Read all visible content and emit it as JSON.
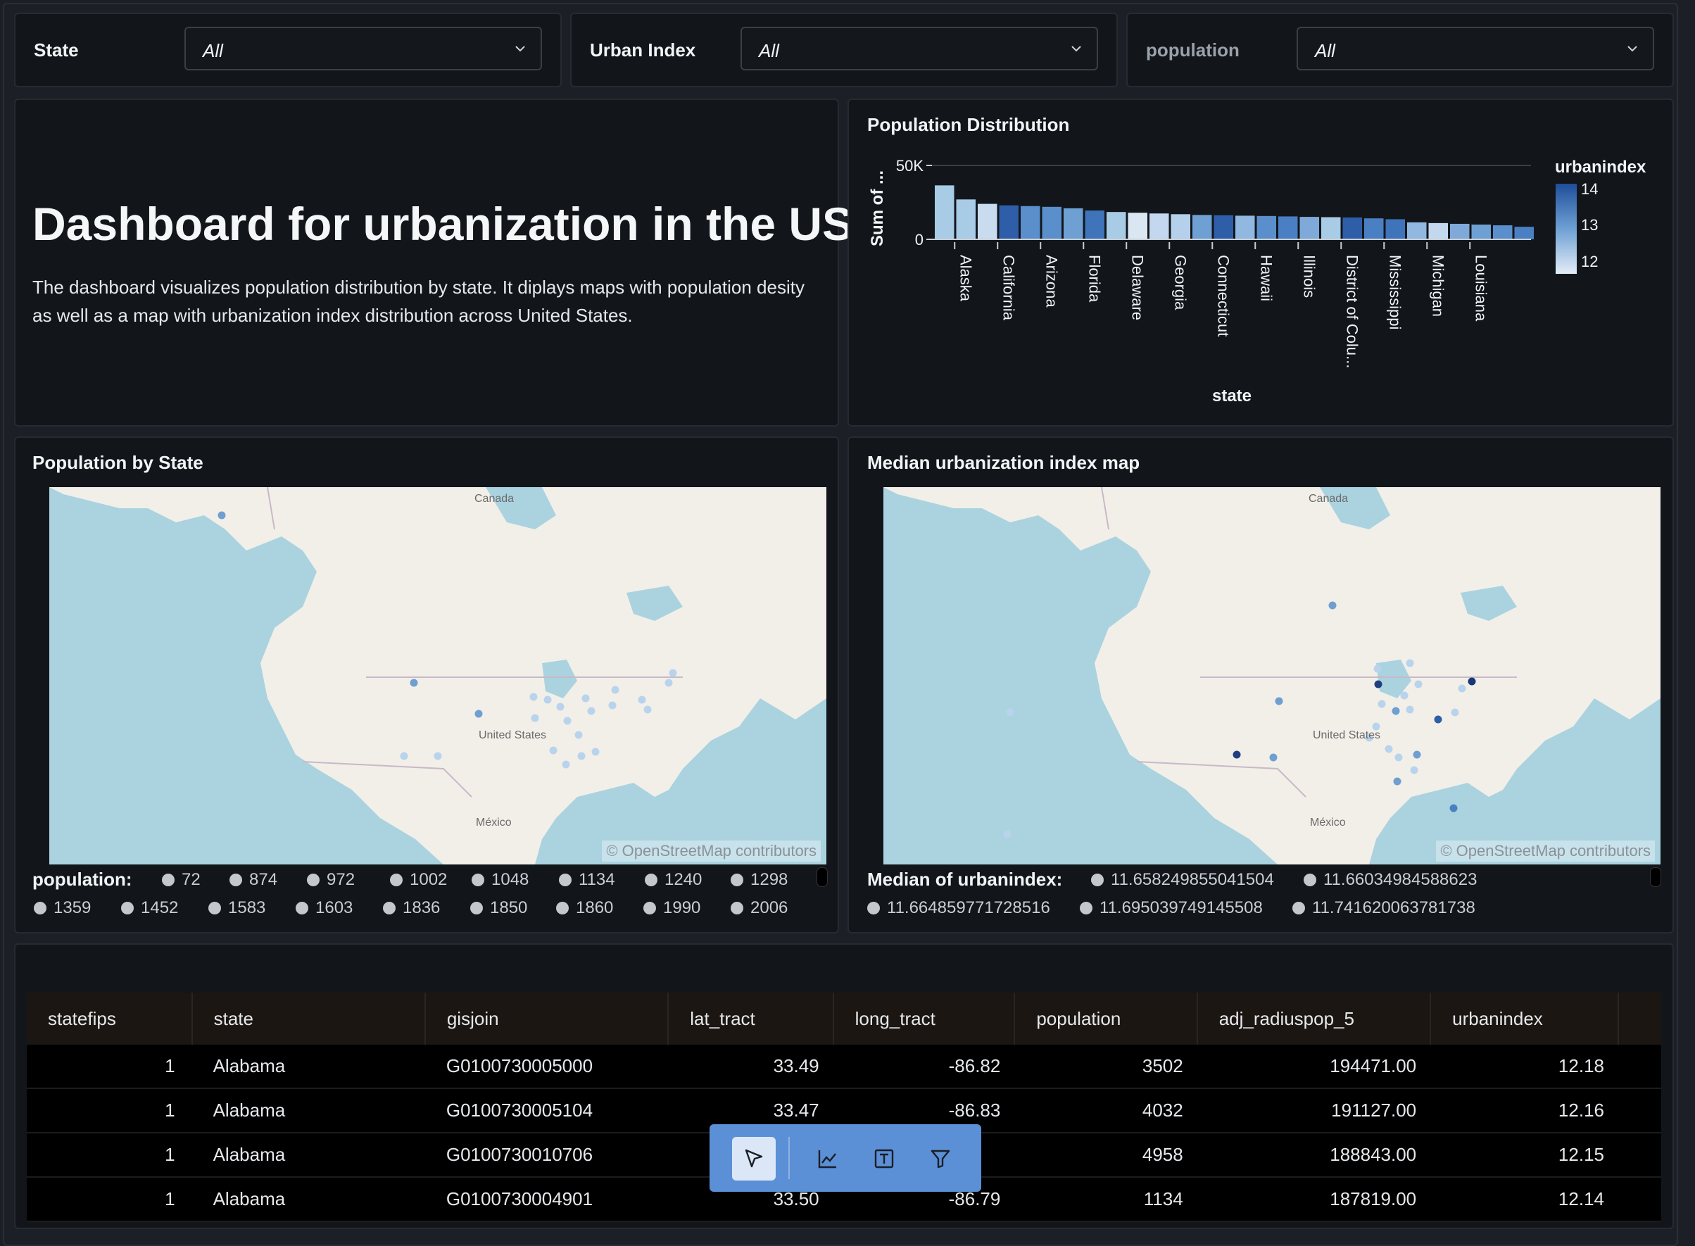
{
  "filters": [
    {
      "label": "State",
      "value": "All"
    },
    {
      "label": "Urban Index",
      "value": "All"
    },
    {
      "label": "population",
      "value": "All"
    }
  ],
  "intro": {
    "title": "Dashboard for urbanization in the US",
    "description": "The dashboard visualizes population distribution by state. It diplays maps with population desity as well as a map with urbanization index distribution across United States."
  },
  "bar_chart": {
    "title": "Population Distribution",
    "ytick_top": "50K",
    "ytick_zero": "0",
    "legend_title": "urbanindex",
    "legend_ticks": [
      "14",
      "13",
      "12"
    ]
  },
  "chart_data": {
    "type": "bar",
    "title": "Population Distribution",
    "xlabel": "state",
    "ylabel": "Sum of ...",
    "ylim": [
      0,
      50000
    ],
    "categories": [
      "Alaska",
      "California",
      "Arizona",
      "Florida",
      "Delaware",
      "Georgia",
      "Connecticut",
      "Hawaii",
      "Illinois",
      "District of Colu...",
      "Mississippi",
      "Michigan",
      "Louisiana"
    ],
    "bars": [
      {
        "value": 36500,
        "color": "#a8cbe6"
      },
      {
        "value": 27000,
        "color": "#a8cbe6"
      },
      {
        "value": 24000,
        "color": "#c9dcef"
      },
      {
        "value": 23000,
        "color": "#2e5ea8"
      },
      {
        "value": 22500,
        "color": "#5a8fcb"
      },
      {
        "value": 22000,
        "color": "#5a8fcb"
      },
      {
        "value": 21000,
        "color": "#6ea0d4"
      },
      {
        "value": 19500,
        "color": "#3f73ba"
      },
      {
        "value": 18500,
        "color": "#a8cbe6"
      },
      {
        "value": 18000,
        "color": "#dbe6f3"
      },
      {
        "value": 17500,
        "color": "#c3d8ee"
      },
      {
        "value": 17000,
        "color": "#b5d0eb"
      },
      {
        "value": 16500,
        "color": "#6ea0d4"
      },
      {
        "value": 16300,
        "color": "#2e5ea8"
      },
      {
        "value": 16000,
        "color": "#90b8e0"
      },
      {
        "value": 15800,
        "color": "#5a8fcb"
      },
      {
        "value": 15500,
        "color": "#4a80c3"
      },
      {
        "value": 15200,
        "color": "#7ea9d8"
      },
      {
        "value": 15000,
        "color": "#a8cbe6"
      },
      {
        "value": 14800,
        "color": "#2e5ea8"
      },
      {
        "value": 14200,
        "color": "#4a80c3"
      },
      {
        "value": 13600,
        "color": "#3f73ba"
      },
      {
        "value": 11500,
        "color": "#90b8e0"
      },
      {
        "value": 11000,
        "color": "#c3d8ee"
      },
      {
        "value": 10500,
        "color": "#7ea9d8"
      },
      {
        "value": 10000,
        "color": "#6ea0d4"
      },
      {
        "value": 9500,
        "color": "#5a8fcb"
      },
      {
        "value": 8500,
        "color": "#4a80c3"
      }
    ]
  },
  "map1": {
    "title": "Population by State",
    "label_canada": "Canada",
    "label_us": "United States",
    "label_mexico": "México",
    "attribution": "© OpenStreetMap contributors",
    "legend_title": "population:",
    "legend_items": [
      "72",
      "874",
      "972",
      "1002",
      "1048",
      "1134",
      "1240",
      "1298",
      "1359",
      "1452",
      "1583",
      "1603",
      "1836",
      "1850",
      "1860",
      "1990",
      "2006"
    ]
  },
  "map2": {
    "title": "Median urbanization index map",
    "label_canada": "Canada",
    "label_us": "United States",
    "label_mexico": "México",
    "attribution": "© OpenStreetMap contributors",
    "legend_title": "Median of urbanindex:",
    "legend_items": [
      "11.658249855041504",
      "11.66034984588623",
      "11.664859771728516",
      "11.695039749145508",
      "11.741620063781738"
    ]
  },
  "table": {
    "columns": [
      "statefips",
      "state",
      "gisjoin",
      "lat_tract",
      "long_tract",
      "population",
      "adj_radiuspop_5",
      "urbanindex"
    ],
    "rows": [
      [
        "1",
        "Alabama",
        "G0100730005000",
        "33.49",
        "-86.82",
        "3502",
        "194471.00",
        "12.18"
      ],
      [
        "1",
        "Alabama",
        "G0100730005104",
        "33.47",
        "-86.83",
        "4032",
        "191127.00",
        "12.16"
      ],
      [
        "1",
        "Alabama",
        "G0100730010706",
        "",
        "",
        "4958",
        "188843.00",
        "12.15"
      ],
      [
        "1",
        "Alabama",
        "G0100730004901",
        "33.50",
        "-86.79",
        "1134",
        "187819.00",
        "12.14"
      ]
    ]
  },
  "toolbar": {
    "tools": [
      "pointer-tool",
      "chart-tool",
      "text-tool",
      "filter-tool"
    ],
    "accent": "#5b8fd6"
  }
}
